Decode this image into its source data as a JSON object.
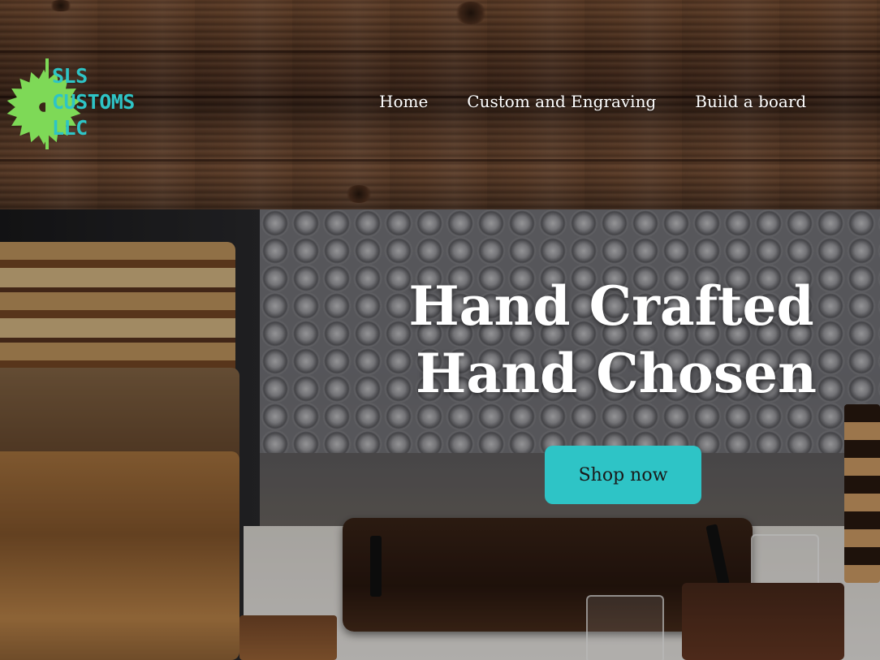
{
  "logo": {
    "line1": "SLS",
    "line2": "CUSTOMS",
    "line3": "LLC",
    "icon": "saw-blade-icon",
    "text_color": "#2ec4c6",
    "icon_color": "#7ed957"
  },
  "nav": {
    "items": [
      {
        "label": "Home"
      },
      {
        "label": "Custom and Engraving"
      },
      {
        "label": "Build a board"
      }
    ]
  },
  "hero": {
    "headline_line1": "Hand Crafted",
    "headline_line2": "Hand Chosen",
    "cta_label": "Shop now",
    "cta_color": "#2ec4c6"
  }
}
